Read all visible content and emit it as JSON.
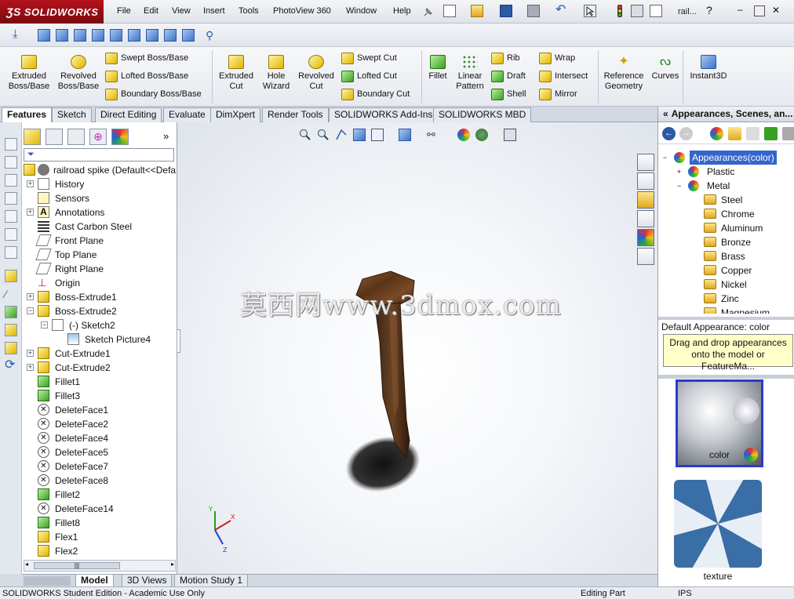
{
  "app": {
    "brand": "SOLIDWORKS",
    "window_title": "rail...",
    "brand_color": "#b3121c"
  },
  "menu": [
    "File",
    "Edit",
    "View",
    "Insert",
    "Tools",
    "PhotoView 360",
    "Window",
    "Help"
  ],
  "command_manager": {
    "features": [
      {
        "label": "Extruded Boss/Base"
      },
      {
        "label": "Revolved Boss/Base"
      },
      {
        "label": "Swept Boss/Base"
      },
      {
        "label": "Lofted Boss/Base"
      },
      {
        "label": "Boundary Boss/Base"
      },
      {
        "label": "Extruded Cut"
      },
      {
        "label": "Hole Wizard"
      },
      {
        "label": "Revolved Cut"
      },
      {
        "label": "Swept Cut"
      },
      {
        "label": "Lofted Cut"
      },
      {
        "label": "Boundary Cut"
      },
      {
        "label": "Fillet"
      },
      {
        "label": "Linear Pattern"
      },
      {
        "label": "Rib"
      },
      {
        "label": "Draft"
      },
      {
        "label": "Shell"
      },
      {
        "label": "Wrap"
      },
      {
        "label": "Intersect"
      },
      {
        "label": "Mirror"
      },
      {
        "label": "Reference Geometry"
      },
      {
        "label": "Curves"
      },
      {
        "label": "Instant3D"
      }
    ]
  },
  "tabs": [
    "Features",
    "Sketch",
    "Direct Editing",
    "Evaluate",
    "DimXpert",
    "Render Tools",
    "SOLIDWORKS Add-Ins",
    "SOLIDWORKS MBD"
  ],
  "active_tab": "Features",
  "feature_tree": {
    "root": "railroad spike  (Default<<Defa",
    "items": [
      "History",
      "Sensors",
      "Annotations",
      "Cast Carbon Steel",
      "Front Plane",
      "Top Plane",
      "Right Plane",
      "Origin",
      "Boss-Extrude1",
      "Boss-Extrude2",
      "(-) Sketch2",
      "Sketch Picture4",
      "Cut-Extrude1",
      "Cut-Extrude2",
      "Fillet1",
      "Fillet3",
      "DeleteFace1",
      "DeleteFace2",
      "DeleteFace4",
      "DeleteFace5",
      "DeleteFace7",
      "DeleteFace8",
      "Fillet2",
      "DeleteFace14",
      "Fillet8",
      "Flex1",
      "Flex2"
    ]
  },
  "graphics": {
    "watermark": "莫西网www.3dmox.com"
  },
  "bottom_tabs": [
    "Model",
    "3D Views",
    "Motion Study 1"
  ],
  "status": {
    "left": "SOLIDWORKS Student Edition - Academic Use Only",
    "mid": "Editing Part",
    "units": "IPS"
  },
  "task_pane": {
    "title": "Appearances, Scenes, an...",
    "tree": {
      "root": "Appearances(color)",
      "groups": [
        "Plastic",
        "Metal"
      ],
      "metals": [
        "Steel",
        "Chrome",
        "Aluminum",
        "Bronze",
        "Brass",
        "Copper",
        "Nickel",
        "Zinc",
        "Magnesium"
      ]
    },
    "default_appearance": "Default Appearance: color",
    "tooltip": "Drag and drop appearances onto the model or FeatureMa...",
    "swatches": [
      "color",
      "texture"
    ]
  }
}
